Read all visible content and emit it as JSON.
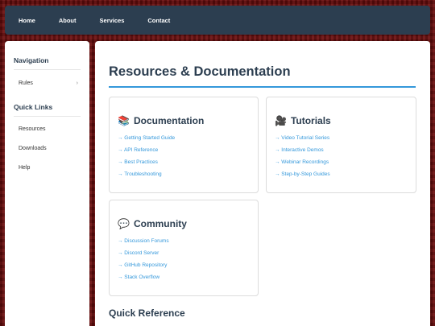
{
  "topnav": {
    "items": [
      {
        "label": "Home"
      },
      {
        "label": "About"
      },
      {
        "label": "Services"
      },
      {
        "label": "Contact"
      }
    ]
  },
  "sidebar": {
    "navigation_heading": "Navigation",
    "nav_items": [
      {
        "label": "Rules",
        "chevron": "›"
      }
    ],
    "quicklinks_heading": "Quick Links",
    "quick_items": [
      {
        "label": "Resources"
      },
      {
        "label": "Downloads"
      },
      {
        "label": "Help"
      }
    ]
  },
  "main": {
    "title": "Resources & Documentation",
    "cards": [
      {
        "icon": "📚",
        "icon_name": "books-icon",
        "title": "Documentation",
        "links": [
          "→ Getting Started Guide",
          "→ API Reference",
          "→ Best Practices",
          "→ Troubleshooting"
        ]
      },
      {
        "icon": "🎥",
        "icon_name": "video-camera-icon",
        "title": "Tutorials",
        "links": [
          "→ Video Tutorial Series",
          "→ Interactive Demos",
          "→ Webinar Recordings",
          "→ Step-by-Step Guides"
        ]
      },
      {
        "icon": "💬",
        "icon_name": "speech-bubble-icon",
        "title": "Community",
        "links": [
          "→ Discussion Forums",
          "→ Discord Server",
          "→ GitHub Repository",
          "→ Stack Overflow"
        ]
      }
    ],
    "quick_reference_heading": "Quick Reference"
  },
  "colors": {
    "nav_bg": "#2c3e50",
    "heading": "#2c3e50",
    "link": "#3498db",
    "accent_rule": "#3498db",
    "page_bg": "#6a0d0d"
  }
}
